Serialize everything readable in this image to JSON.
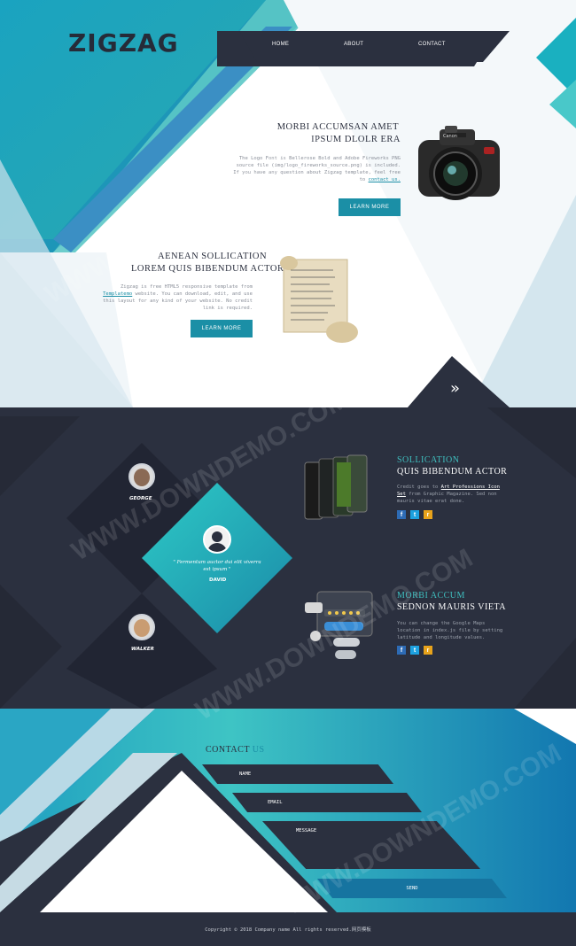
{
  "brand": {
    "logo": "ZIGZAG"
  },
  "nav": {
    "items": [
      "HOME",
      "ABOUT",
      "CONTACT"
    ]
  },
  "features": [
    {
      "title": "MORBI ACCUMSAN AMET",
      "subtitle": "IPSUM DLOLR ERA",
      "body": "The Logo Font is Bellerose Bold and Adobe Fireworks PNG source file (img/logo_fireworks_source.png) is included. If you have any question about Zigzag template, feel free to",
      "link": "contact us.",
      "button": "LEARN MORE"
    },
    {
      "title": "AENEAN SOLLICATION",
      "subtitle": "LOREM QUIS BIBENDUM ACTOR",
      "body_pre": "Zigzag is free HTML5 responsive template from",
      "link": "Templatemo",
      "body_post": "website. You can download, edit, and use this layout for any kind of your website. No credit link is required.",
      "button": "LEARN MORE"
    }
  ],
  "team": {
    "george": "GEORGE",
    "david": "DAVID",
    "walker": "WALKER",
    "quote": "\" Fermentum auctor dui elit viverra est ipsum \""
  },
  "services": [
    {
      "title": "SOLLICATION",
      "subtitle": "QUIS BIBENDUM ACTOR",
      "body_pre": "Credit goes to",
      "link": "Art Professions Icon Set",
      "body_post": "from Graphic Magazine. Sed non mauris vitae erat done."
    },
    {
      "title": "MORBI ACCUM",
      "subtitle": "SEDNON MAURIS VIETA",
      "body": "You can change the Google Maps location in index.js file by setting latitude and longitude values."
    }
  ],
  "contact": {
    "title_main": "CONTACT",
    "title_accent": "US",
    "name_placeholder": "NAME",
    "email_placeholder": "EMAIL",
    "message_placeholder": "MESSAGE",
    "send": "SEND"
  },
  "footer": {
    "copyright": "Copyright © 2018 Company name All rights reserved.网页模板"
  },
  "social": {
    "facebook": "f",
    "twitter": "t",
    "rss": "r"
  },
  "colors": {
    "accent": "#1b8fa6",
    "dark": "#2b303f",
    "teal": "#3fbfbf"
  }
}
